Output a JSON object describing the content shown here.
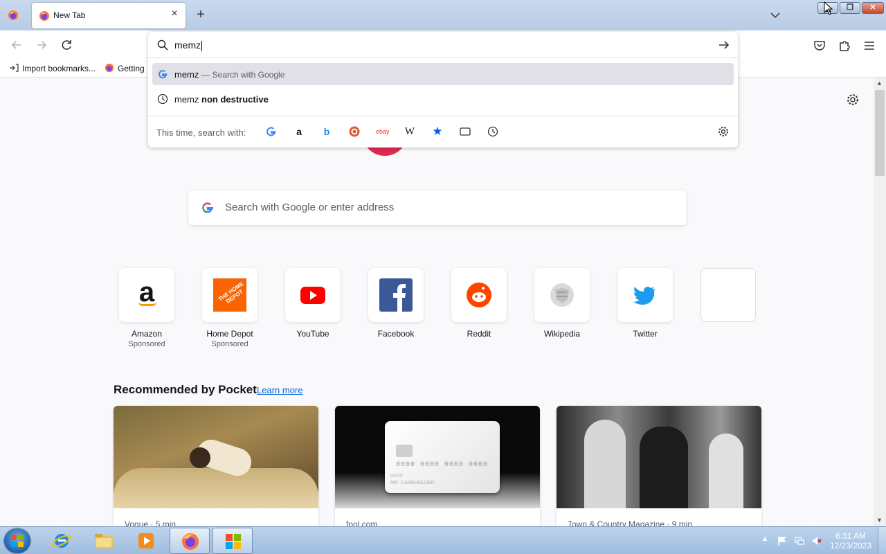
{
  "browser": {
    "tab": {
      "title": "New Tab",
      "close_icon": "close-icon"
    },
    "new_tab_icon": "plus-icon",
    "urlbar": {
      "value": "memz",
      "go_icon": "arrow-right-icon"
    },
    "suggestions": [
      {
        "term": "memz",
        "separator": "—",
        "hint": "Search with Google",
        "icon": "google-icon",
        "selected": true
      },
      {
        "prefix": "memz",
        "bold": "non destructive",
        "icon": "history-icon",
        "selected": false
      }
    ],
    "one_off": {
      "label": "This time, search with:",
      "engines": [
        "google-icon",
        "amazon-icon",
        "bing-icon",
        "duckduckgo-icon",
        "ebay-icon",
        "wikipedia-icon",
        "bookmarks-star-icon",
        "tabs-icon",
        "history-icon"
      ],
      "ebay_text": "ebay",
      "wiki_text": "W",
      "settings_icon": "gear-icon"
    },
    "bookmarks": [
      {
        "label": "Import bookmarks...",
        "icon": "import-icon"
      },
      {
        "label": "Getting",
        "icon": "firefox-icon"
      }
    ]
  },
  "newtab": {
    "search_placeholder": "Search with Google or enter address",
    "shortcuts": [
      {
        "name": "Amazon",
        "sponsored": "Sponsored",
        "icon": "amazon-icon"
      },
      {
        "name": "Home Depot",
        "sponsored": "Sponsored",
        "icon": "home-depot-icon"
      },
      {
        "name": "YouTube",
        "sponsored": "",
        "icon": "youtube-icon"
      },
      {
        "name": "Facebook",
        "sponsored": "",
        "icon": "facebook-icon"
      },
      {
        "name": "Reddit",
        "sponsored": "",
        "icon": "reddit-icon"
      },
      {
        "name": "Wikipedia",
        "sponsored": "",
        "icon": "wikipedia-icon"
      },
      {
        "name": "Twitter",
        "sponsored": "",
        "icon": "twitter-icon"
      },
      {
        "name": "",
        "sponsored": "",
        "icon": "empty-tile"
      }
    ],
    "home_depot_text": "THE HOME DEPOT",
    "pocket": {
      "title": "Recommended by Pocket",
      "learn_more": "Learn more",
      "cards": [
        {
          "source": "Vogue · 5 min"
        },
        {
          "source": "fool.com"
        },
        {
          "source": "Town & Country Magazine · 9 min"
        }
      ],
      "card_digits": "0000 0000 0000 0000",
      "card_date": "04/23",
      "card_holder": "MR. CARDHOLDER"
    }
  },
  "taskbar": {
    "clock_time": "6:31 AM",
    "clock_date": "12/23/2023",
    "apps": [
      "internet-explorer-icon",
      "explorer-folder-icon",
      "media-player-icon",
      "firefox-icon",
      "windows-app-icon"
    ]
  },
  "colors": {
    "accent": "#0061e0",
    "tabstrip": "#c9d9ee",
    "taskbar": "#a9c4e4"
  }
}
